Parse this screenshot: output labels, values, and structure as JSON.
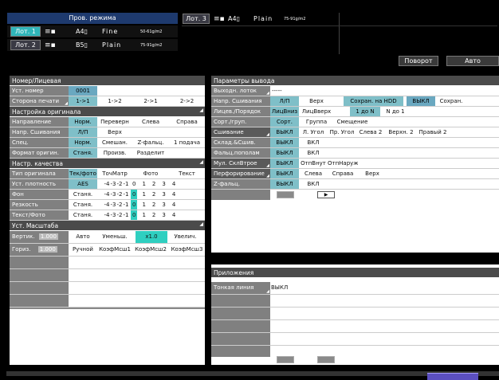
{
  "top": {
    "mode_label": "Пров. режима",
    "tray_active": "Лот. 3",
    "tray_active_size": "A4",
    "tray_active_type": "Plain",
    "tray_active_weight": "75-91g/m2",
    "trays": [
      {
        "label": "Лот. 1",
        "size": "A4",
        "type": "Fine",
        "weight": "50-61g/m2",
        "selected": true
      },
      {
        "label": "Лот. 2",
        "size": "B5",
        "type": "Plain",
        "weight": "75-91g/m2",
        "selected": false
      }
    ],
    "rotate_button": "Поворот",
    "auto_button": "Авто"
  },
  "left": {
    "sections": {
      "number_face": "Номер/Лицевая",
      "original_setting": "Настройка оригинала",
      "quality_setting": "Настр. качества",
      "zoom": "Уст. Масштаба"
    },
    "rows": {
      "set_number": {
        "label": "Уст. номер",
        "value": "0001"
      },
      "print_side": {
        "label": "Сторона печати",
        "options": [
          "1->1",
          "1->2",
          "2->1",
          "2->2"
        ]
      },
      "direction": {
        "label": "Направление",
        "options": [
          "Норм.",
          "Переверн",
          "Слева",
          "Справа"
        ]
      },
      "binding_dir": {
        "label": "Напр. Сшивания",
        "options": [
          "Л/П",
          "Верх"
        ]
      },
      "special": {
        "label": "Спец.",
        "options": [
          "Норм.",
          "Смешан.",
          "Z-фальц.",
          "1 подача"
        ]
      },
      "orig_format": {
        "label": "Формат оригин.",
        "options": [
          "Станя.",
          "Произв.",
          "Разделит"
        ]
      },
      "orig_type": {
        "label": "Тип оригинала",
        "options": [
          "Тек/фото",
          "ТочМатр",
          "Фото",
          "Текст"
        ]
      },
      "density": {
        "label": "Уст. плотность",
        "options": [
          "AES",
          "-4",
          "-3",
          "-2",
          "-1",
          "0",
          "1",
          "2",
          "3",
          "4"
        ]
      },
      "background": {
        "label": "Фон",
        "options": [
          "Станя.",
          "-4",
          "-3",
          "-2",
          "-1",
          "0",
          "1",
          "2",
          "3",
          "4"
        ]
      },
      "sharpness": {
        "label": "Резкость",
        "options": [
          "Станя.",
          "-4",
          "-3",
          "-2",
          "-1",
          "0",
          "1",
          "2",
          "3",
          "4"
        ]
      },
      "text_photo": {
        "label": "Текст/Фото",
        "options": [
          "Станя.",
          "-4",
          "-3",
          "-2",
          "-1",
          "0",
          "1",
          "2",
          "3",
          "4"
        ]
      },
      "vertical": {
        "label": "Вертик.",
        "value": "1.000",
        "options": [
          "Авто",
          "Уменьш.",
          "x1.0",
          "Увелич."
        ]
      },
      "horizontal": {
        "label": "Гориз.",
        "value": "1.000",
        "options": [
          "Ручной",
          "КоэфМсш1",
          "КоэфМсш2",
          "КоэфМсш3"
        ]
      }
    }
  },
  "right": {
    "header": "Параметры вывода",
    "rows": {
      "output_tray": {
        "label": "Выходн. лоток",
        "value": "-----"
      },
      "binding_dir": {
        "label": "Напр. Сшивания",
        "options": [
          "Л/П",
          "Верх"
        ]
      },
      "save_hdd": {
        "label": "Сохран. на HDD",
        "options": [
          "ВЫКЛ",
          "Сохран."
        ]
      },
      "face_order": {
        "label": "Лицев./Порядок",
        "options": [
          "ЛицВниз",
          "ЛицВверх"
        ]
      },
      "one_to_n": {
        "options": [
          "1 до N",
          "N до 1"
        ]
      },
      "sort_group": {
        "label": "Сорт./груп.",
        "options": [
          "Сорт.",
          "Группа",
          "Смещение"
        ]
      },
      "stapling": {
        "label": "Сшивание",
        "options": [
          "ВЫКЛ",
          "Л. Угол",
          "Пр. Угол",
          "Слева 2",
          "Верхн. 2",
          "Правый 2"
        ]
      },
      "fold_staple": {
        "label": "Склад.&Сшив.",
        "options": [
          "ВЫКЛ",
          "ВКЛ"
        ]
      },
      "half_fold": {
        "label": "Фальц.пополам",
        "options": [
          "ВЫКЛ",
          "ВКЛ"
        ]
      },
      "multi_fold": {
        "label": "Мул. СклВтрое",
        "options": [
          "ВЫКЛ",
          "ОтпВнут",
          "ОтпНаруж"
        ]
      },
      "punch": {
        "label": "Перфорирование",
        "options": [
          "ВЫКЛ",
          "Слева",
          "Справа",
          "Верх"
        ]
      },
      "z_fold": {
        "label": "Z-фальц.",
        "options": [
          "ВЫКЛ",
          "ВКЛ"
        ]
      }
    },
    "apps": {
      "header": "Приложения",
      "thin_line": {
        "label": "Тонкая линия",
        "value": "ВЫКЛ"
      }
    }
  },
  "colors": {
    "accent": "#2fb5b9",
    "selected": "#7fbfc8",
    "header": "#4b4b4b",
    "label": "#808080"
  }
}
